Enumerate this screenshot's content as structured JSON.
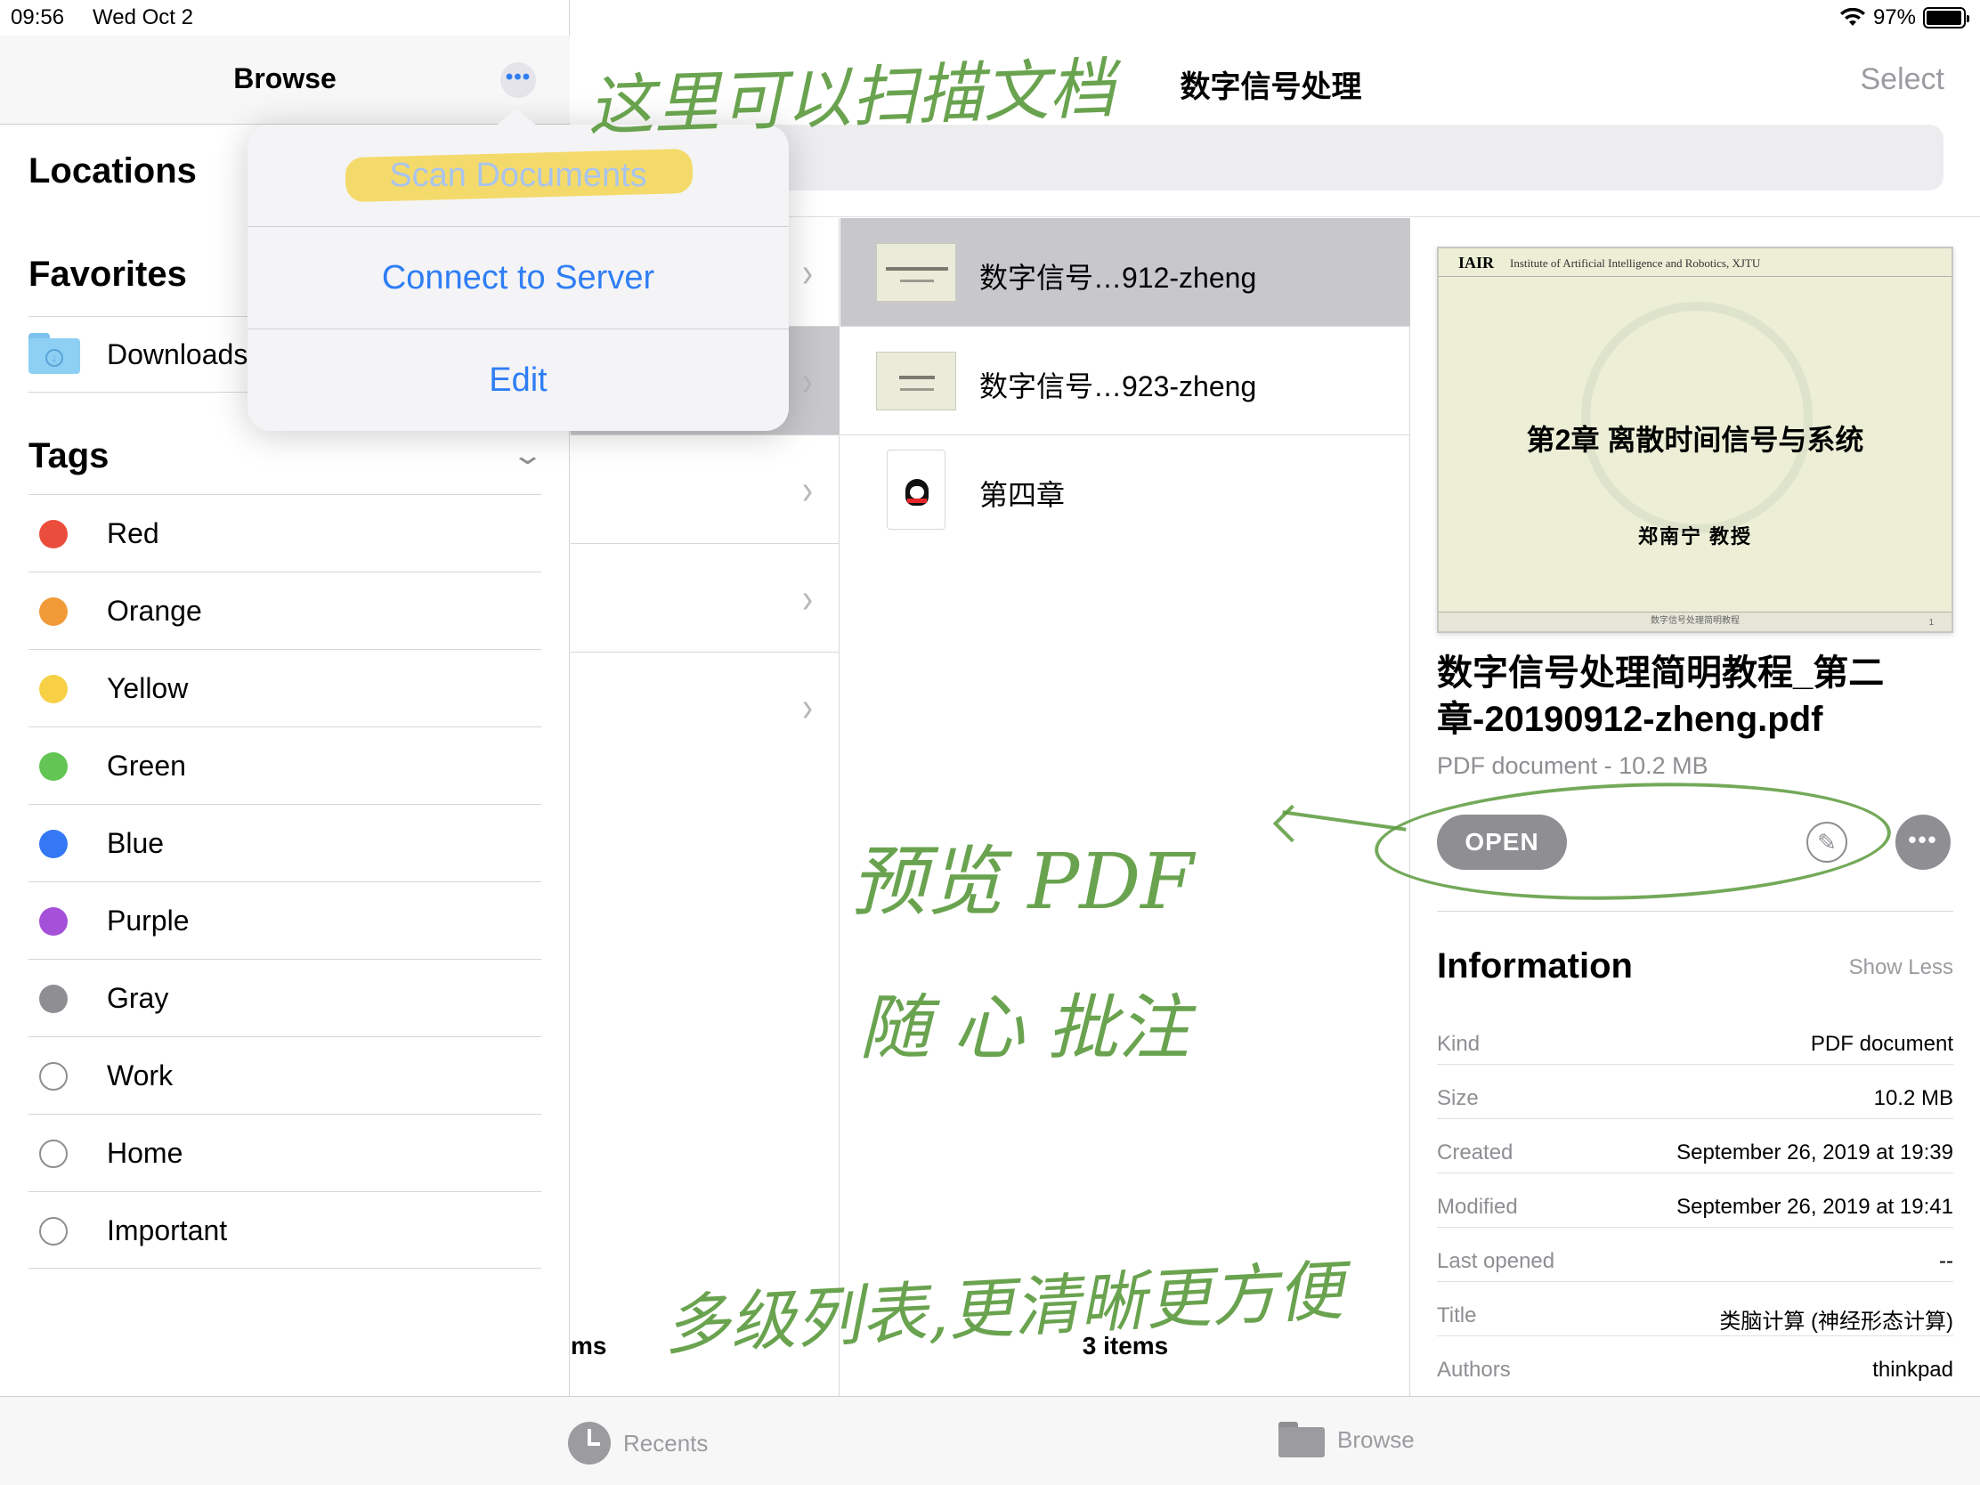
{
  "status_bar": {
    "time": "09:56",
    "date": "Wed Oct 2",
    "battery": "97%",
    "battery_level": 0.97
  },
  "sidebar": {
    "title": "Browse",
    "locations_heading": "Locations",
    "favorites_heading": "Favorites",
    "favorites": [
      {
        "label": "Downloads",
        "icon": "folder-download-icon"
      }
    ],
    "tags_heading": "Tags",
    "tags": [
      {
        "label": "Red",
        "color": "#eb4d3d"
      },
      {
        "label": "Orange",
        "color": "#f19a38"
      },
      {
        "label": "Yellow",
        "color": "#f7d046"
      },
      {
        "label": "Green",
        "color": "#62c554"
      },
      {
        "label": "Blue",
        "color": "#3478f6"
      },
      {
        "label": "Purple",
        "color": "#a550d8"
      },
      {
        "label": "Gray",
        "color": "#8e8e93"
      },
      {
        "label": "Work",
        "color": ""
      },
      {
        "label": "Home",
        "color": ""
      },
      {
        "label": "Important",
        "color": ""
      }
    ]
  },
  "popover": {
    "scan": "Scan Documents",
    "connect": "Connect to Server",
    "edit": "Edit"
  },
  "main": {
    "title": "数字信号处理",
    "select": "Select",
    "col1_count": "ms",
    "col2_count": "3 items",
    "files": [
      {
        "name": "数字信号…912-zheng",
        "type": "pdf",
        "selected": true
      },
      {
        "name": "数字信号…923-zheng",
        "type": "pdf",
        "selected": false
      },
      {
        "name": "第四章",
        "type": "qq-doc",
        "selected": false
      }
    ]
  },
  "preview": {
    "logo": "IAIR",
    "institute": "Institute of Artificial Intelligence and Robotics, XJTU",
    "title": "第2章  离散时间信号与系统",
    "author": "郑南宁  教授",
    "footer": "数字信号处理简明教程",
    "page": "1"
  },
  "detail": {
    "filename": "数字信号处理简明教程_第二章-20190912-zheng.pdf",
    "kind": "PDF document - 10.2 MB",
    "open": "OPEN",
    "info_heading": "Information",
    "show_less": "Show Less",
    "info": [
      {
        "key": "Kind",
        "value": "PDF document"
      },
      {
        "key": "Size",
        "value": "10.2 MB"
      },
      {
        "key": "Created",
        "value": "September 26, 2019 at 19:39"
      },
      {
        "key": "Modified",
        "value": "September 26, 2019 at 19:41"
      },
      {
        "key": "Last opened",
        "value": "--"
      },
      {
        "key": "Title",
        "value": "类脑计算 (神经形态计算)"
      },
      {
        "key": "Authors",
        "value": "thinkpad"
      }
    ]
  },
  "tabbar": {
    "recents": "Recents",
    "browse": "Browse"
  },
  "annotations": {
    "top": "这里可以扫描文档",
    "preview": "预览 PDF",
    "annotate": "随 心 批注",
    "bottom": "多级列表,更清晰更方便"
  }
}
